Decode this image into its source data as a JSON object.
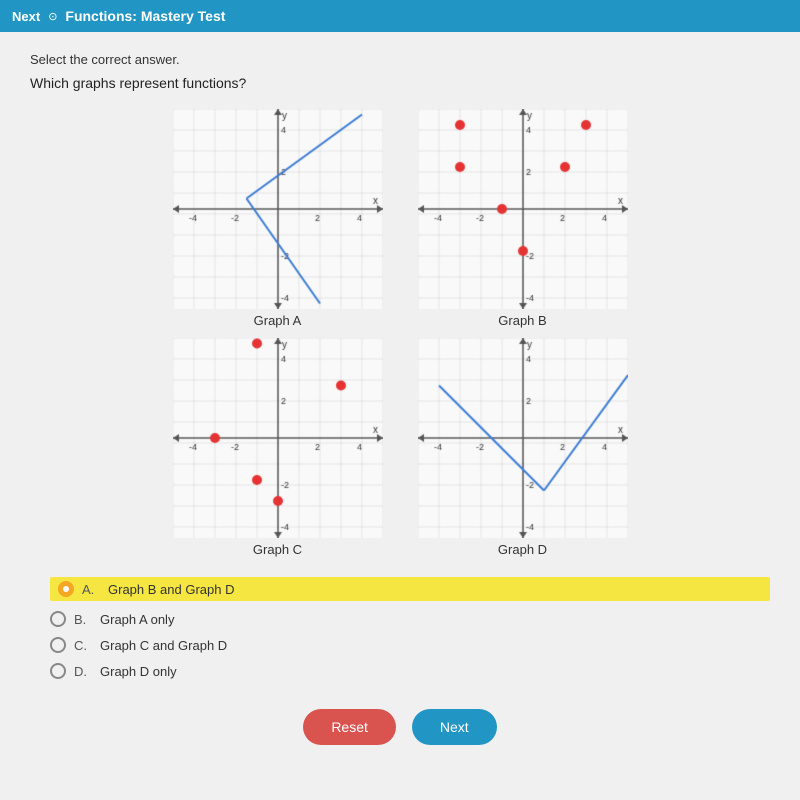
{
  "titlebar": {
    "next_label": "Next",
    "title": "Functions: Mastery Test"
  },
  "page": {
    "instruction": "Select the correct answer.",
    "question": "Which graphs represent functions?"
  },
  "graphs": [
    {
      "id": "A",
      "label": "Graph A"
    },
    {
      "id": "B",
      "label": "Graph B"
    },
    {
      "id": "C",
      "label": "Graph C"
    },
    {
      "id": "D",
      "label": "Graph D"
    }
  ],
  "options": [
    {
      "letter": "A.",
      "text": "Graph B and Graph D",
      "selected": true
    },
    {
      "letter": "B.",
      "text": "Graph A only",
      "selected": false
    },
    {
      "letter": "C.",
      "text": "Graph C and Graph D",
      "selected": false
    },
    {
      "letter": "D.",
      "text": "Graph D only",
      "selected": false
    }
  ],
  "buttons": {
    "reset": "Reset",
    "next": "Next"
  },
  "colors": {
    "accent_blue": "#2196c4",
    "selected_yellow": "#f5e642",
    "selected_orange": "#f5a623"
  }
}
